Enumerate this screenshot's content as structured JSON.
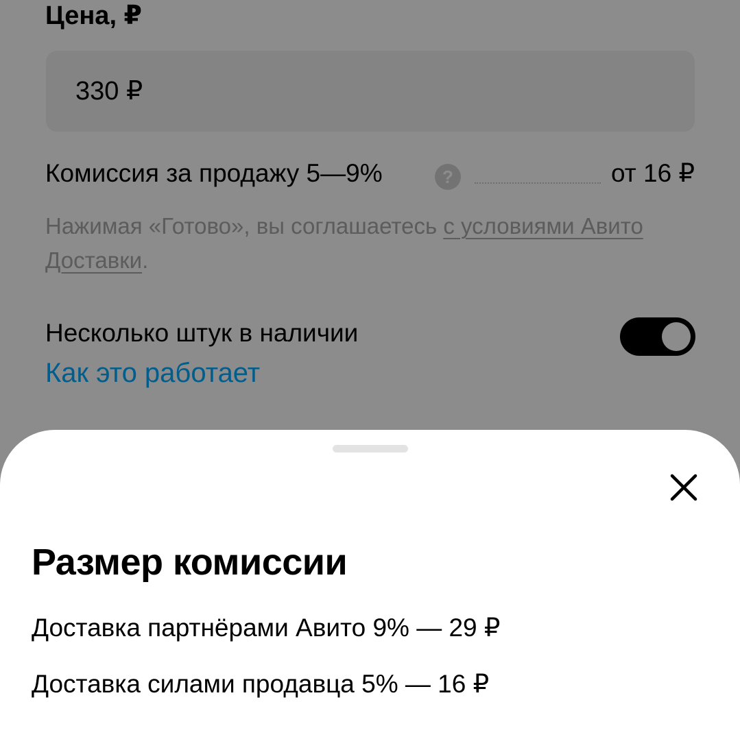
{
  "form": {
    "price_label": "Цена, ₽",
    "price_value": "330 ₽",
    "commission_label": "Комиссия за продажу 5—9%",
    "commission_help_icon": "question-icon",
    "commission_help_glyph": "?",
    "commission_value": "от 16 ₽",
    "terms_text": "Нажимая «Готово», вы соглашаетесь ",
    "terms_link": "с условиями Авито Доставки",
    "terms_end": ".",
    "multiple_label": "Несколько штук в наличии",
    "how_it_works_link": "Как это работает",
    "multiple_toggle_on": true
  },
  "sheet": {
    "close_icon": "close-icon",
    "title": "Размер комиссии",
    "lines": [
      "Доставка партнёрами Авито 9% — 29 ₽",
      "Доставка силами продавца 5% — 16 ₽"
    ]
  },
  "colors": {
    "link_blue": "#00aaff",
    "toggle_on": "#000000",
    "scrim": "rgba(0,0,0,0.45)"
  }
}
